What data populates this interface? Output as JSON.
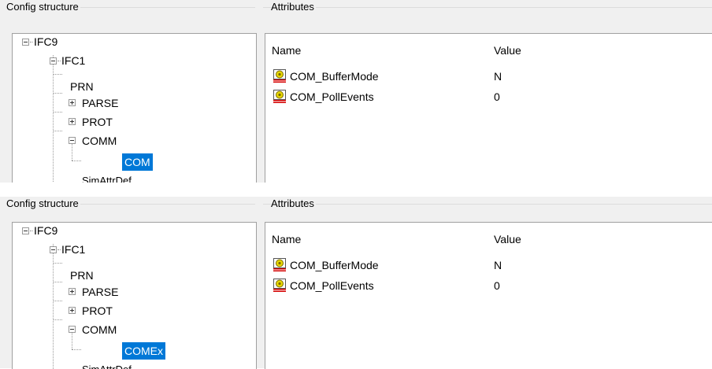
{
  "panels": [
    {
      "config_title": "Config structure",
      "attributes_title": "Attributes",
      "tree": {
        "root": "IFC9",
        "child": "IFC1",
        "items": [
          "PRN",
          "PARSE",
          "PROT",
          "COMM"
        ],
        "selected": "COM",
        "partial": "SimAttrDef"
      },
      "columns": {
        "name": "Name",
        "value": "Value"
      },
      "rows": [
        {
          "name": "COM_BufferMode",
          "value": "N"
        },
        {
          "name": "COM_PollEvents",
          "value": "0"
        }
      ]
    },
    {
      "config_title": "Config structure",
      "attributes_title": "Attributes",
      "tree": {
        "root": "IFC9",
        "child": "IFC1",
        "items": [
          "PRN",
          "PARSE",
          "PROT",
          "COMM"
        ],
        "selected": "COMEx",
        "partial": "SimAttrDef"
      },
      "columns": {
        "name": "Name",
        "value": "Value"
      },
      "rows": [
        {
          "name": "COM_BufferMode",
          "value": "N"
        },
        {
          "name": "COM_PollEvents",
          "value": "0"
        }
      ]
    }
  ],
  "icon": "attribute-icon",
  "selection_color": "#0078d7"
}
